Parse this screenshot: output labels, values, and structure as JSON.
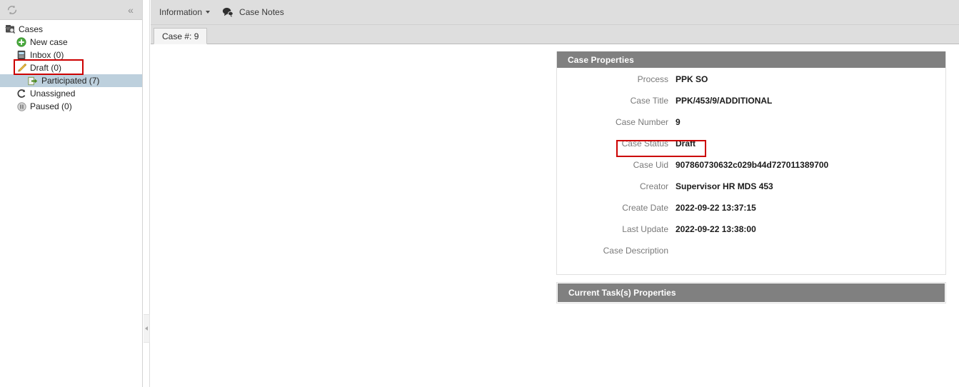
{
  "sidebar": {
    "refresh_icon": "refresh-icon",
    "collapse_icon": "collapse-left-icon",
    "collapse_glyph": "«",
    "tree": [
      {
        "label": "Cases",
        "icon": "cases-folder-icon",
        "level": 0,
        "selected": false,
        "expander": true
      },
      {
        "label": "New case",
        "icon": "add-green-icon",
        "level": 1,
        "selected": false,
        "expander": false
      },
      {
        "label": "Inbox (0)",
        "icon": "inbox-icon",
        "level": 1,
        "selected": false,
        "expander": false
      },
      {
        "label": "Draft (0)",
        "icon": "pencil-icon",
        "level": 1,
        "selected": false,
        "expander": false
      },
      {
        "label": "Participated (7)",
        "icon": "arrow-out-icon",
        "level": 2,
        "selected": true,
        "expander": false
      },
      {
        "label": "Unassigned",
        "icon": "unassigned-icon",
        "level": 1,
        "selected": false,
        "expander": false
      },
      {
        "label": "Paused (0)",
        "icon": "pause-icon",
        "level": 1,
        "selected": false,
        "expander": false
      }
    ]
  },
  "splitter": {
    "collapse_icon": "splitter-collapse-icon"
  },
  "toolbar": {
    "information_label": "Information",
    "information_icon": "chevron-down-icon",
    "notes_icon": "comments-icon",
    "case_notes_label": "Case Notes"
  },
  "tabs": [
    {
      "label": "Case #: 9",
      "active": true
    }
  ],
  "case_properties": {
    "title": "Case Properties",
    "rows": [
      {
        "label": "Process",
        "value": "PPK SO"
      },
      {
        "label": "Case Title",
        "value": "PPK/453/9/ADDITIONAL"
      },
      {
        "label": "Case Number",
        "value": "9"
      },
      {
        "label": "Case Status",
        "value": "Draft"
      },
      {
        "label": "Case Uid",
        "value": "907860730632c029b44d727011389700"
      },
      {
        "label": "Creator",
        "value": "Supervisor HR MDS 453"
      },
      {
        "label": "Create Date",
        "value": "2022-09-22 13:37:15"
      },
      {
        "label": "Last Update",
        "value": "2022-09-22 13:38:00"
      },
      {
        "label": "Case Description",
        "value": ""
      }
    ]
  },
  "current_task_properties": {
    "title": "Current Task(s) Properties"
  },
  "annotations": {
    "highlight_color": "#cc0000",
    "draft_box": "draft-row-highlight",
    "status_box": "case-status-highlight"
  },
  "colors": {
    "toolbar_bg": "#dedede",
    "panel_header_bg": "#808080",
    "selected_row_bg": "#bdd0dd",
    "label_text": "#7a7a7a",
    "value_text": "#1a1a1a"
  }
}
